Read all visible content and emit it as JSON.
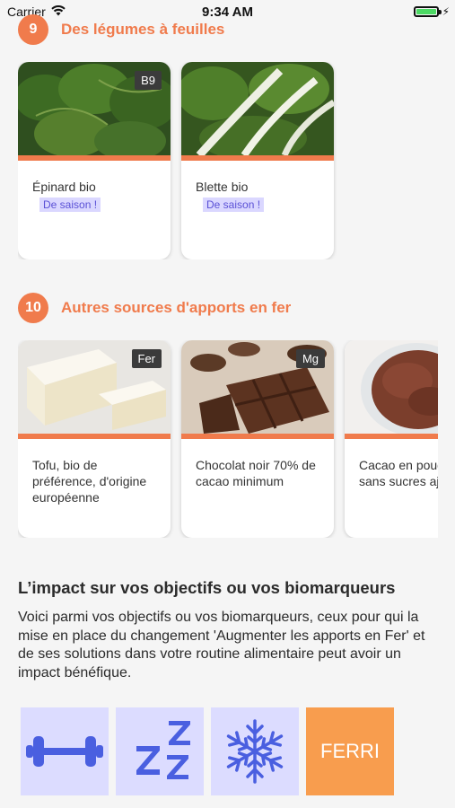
{
  "status_bar": {
    "carrier": "Carrier",
    "time": "9:34 AM",
    "icons": {
      "wifi": "wifi-icon",
      "battery": "battery-icon",
      "charging": "charging-bolt-icon"
    }
  },
  "sections": [
    {
      "number": "9",
      "title": "Des légumes à feuilles",
      "cards": [
        {
          "name": "Épinard bio",
          "tag": "B9",
          "season": "De saison !",
          "image": "spinach-image"
        },
        {
          "name": "Blette bio",
          "tag": "",
          "season": "De saison !",
          "image": "chard-image"
        }
      ]
    },
    {
      "number": "10",
      "title": "Autres sources d'apports en fer",
      "cards": [
        {
          "name": "Tofu, bio de préférence, d'origine européenne",
          "tag": "Fer",
          "image": "tofu-image"
        },
        {
          "name": "Chocolat noir 70% de cacao minimum",
          "tag": "Mg",
          "image": "chocolate-image"
        },
        {
          "name": "Cacao en poudre sans sucres ajoutés",
          "tag": "",
          "image": "cocoa-image"
        }
      ]
    }
  ],
  "impact": {
    "title": "L’impact sur vos objectifs ou vos biomarqueurs",
    "text": "Voici parmi vos objectifs ou vos biomarqueurs, ceux pour qui la mise en place du changement 'Augmenter les apports en Fer' et de ses solutions dans votre routine alimentaire peut avoir un impact bénéfique.",
    "tiles": [
      {
        "icon": "dumbbell-icon"
      },
      {
        "icon": "sleep-zzz-icon"
      },
      {
        "icon": "snowflake-icon"
      },
      {
        "label": "FERRI"
      }
    ]
  },
  "colors": {
    "accent": "#f07b4c",
    "season_bg": "#dad7ff",
    "season_text": "#5a50d6",
    "tile_bg": "#dcdcff",
    "tile_icon": "#4a5fe0",
    "ferri_bg": "#f89d4e"
  }
}
